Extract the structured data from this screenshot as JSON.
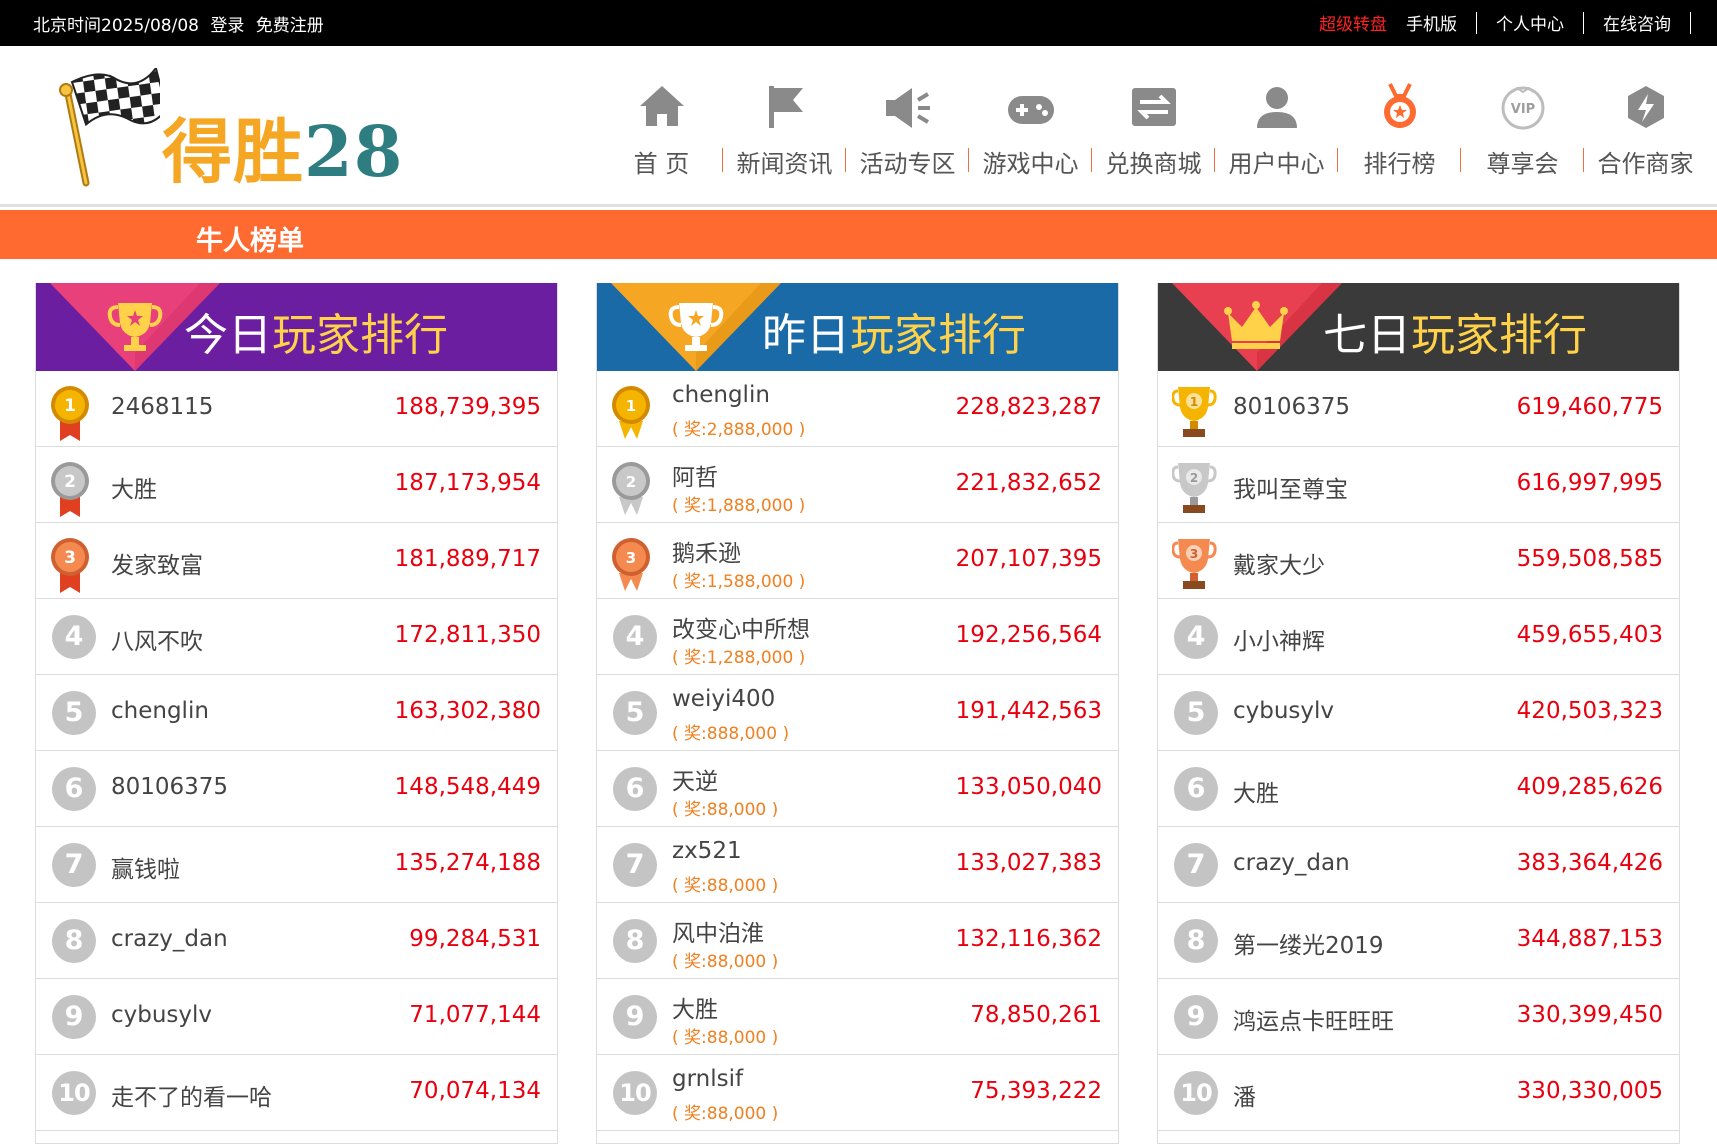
{
  "topbar": {
    "date_text": "北京时间2025/08/08",
    "login": "登录",
    "register": "免费注册",
    "links": [
      "超级转盘",
      "手机版",
      "个人中心",
      "在线咨询"
    ]
  },
  "logo": {
    "text_cn": "得胜",
    "text_num": "28"
  },
  "nav": [
    {
      "label": "首 页",
      "icon": "home-icon"
    },
    {
      "label": "新闻资讯",
      "icon": "flag-icon"
    },
    {
      "label": "活动专区",
      "icon": "megaphone-icon"
    },
    {
      "label": "游戏中心",
      "icon": "gamepad-icon"
    },
    {
      "label": "兑换商城",
      "icon": "exchange-icon"
    },
    {
      "label": "用户中心",
      "icon": "user-icon"
    },
    {
      "label": "排行榜",
      "icon": "medal-icon"
    },
    {
      "label": "尊享会",
      "icon": "vip-icon"
    },
    {
      "label": "合作商家",
      "icon": "partner-icon"
    }
  ],
  "band_title": "牛人榜单",
  "colors": {
    "topbar": "#000000",
    "band": "#ff6a30",
    "score": "#e8000f",
    "prize": "#f08020",
    "panel1": "#6b1fa0",
    "panel2": "#1a6aa8",
    "panel3": "#3a3a3a"
  },
  "panels": [
    {
      "title_white": "今日",
      "title_yellow": "玩家排行",
      "rows": [
        {
          "rank": "1",
          "name": "2468115",
          "score": "188,739,395"
        },
        {
          "rank": "2",
          "name": "大胜",
          "score": "187,173,954"
        },
        {
          "rank": "3",
          "name": "发家致富",
          "score": "181,889,717"
        },
        {
          "rank": "4",
          "name": "八风不吹",
          "score": "172,811,350"
        },
        {
          "rank": "5",
          "name": "chenglin",
          "score": "163,302,380"
        },
        {
          "rank": "6",
          "name": "80106375",
          "score": "148,548,449"
        },
        {
          "rank": "7",
          "name": "赢钱啦",
          "score": "135,274,188"
        },
        {
          "rank": "8",
          "name": "crazy_dan",
          "score": "99,284,531"
        },
        {
          "rank": "9",
          "name": "cybusylv",
          "score": "71,077,144"
        },
        {
          "rank": "10",
          "name": "走不了的看一哈",
          "score": "70,074,134"
        }
      ]
    },
    {
      "title_white": "昨日",
      "title_yellow": "玩家排行",
      "rows": [
        {
          "rank": "1",
          "name": "chenglin",
          "prize": "( 奖:2,888,000 )",
          "score": "228,823,287"
        },
        {
          "rank": "2",
          "name": "阿哲",
          "prize": "( 奖:1,888,000 )",
          "score": "221,832,652"
        },
        {
          "rank": "3",
          "name": "鹅禾逊",
          "prize": "( 奖:1,588,000 )",
          "score": "207,107,395"
        },
        {
          "rank": "4",
          "name": "改变心中所想",
          "prize": "( 奖:1,288,000 )",
          "score": "192,256,564"
        },
        {
          "rank": "5",
          "name": "weiyi400",
          "prize": "( 奖:888,000 )",
          "score": "191,442,563"
        },
        {
          "rank": "6",
          "name": "天逆",
          "prize": "( 奖:88,000 )",
          "score": "133,050,040"
        },
        {
          "rank": "7",
          "name": "zx521",
          "prize": "( 奖:88,000 )",
          "score": "133,027,383"
        },
        {
          "rank": "8",
          "name": "风中泊淮",
          "prize": "( 奖:88,000 )",
          "score": "132,116,362"
        },
        {
          "rank": "9",
          "name": "大胜",
          "prize": "( 奖:88,000 )",
          "score": "78,850,261"
        },
        {
          "rank": "10",
          "name": "grnlsif",
          "prize": "( 奖:88,000 )",
          "score": "75,393,222"
        }
      ]
    },
    {
      "title_white": "七日",
      "title_yellow": "玩家排行",
      "rows": [
        {
          "rank": "1",
          "name": "80106375",
          "score": "619,460,775"
        },
        {
          "rank": "2",
          "name": "我叫至尊宝",
          "score": "616,997,995"
        },
        {
          "rank": "3",
          "name": "戴家大少",
          "score": "559,508,585"
        },
        {
          "rank": "4",
          "name": "小小神辉",
          "score": "459,655,403"
        },
        {
          "rank": "5",
          "name": "cybusylv",
          "score": "420,503,323"
        },
        {
          "rank": "6",
          "name": "大胜",
          "score": "409,285,626"
        },
        {
          "rank": "7",
          "name": "crazy_dan",
          "score": "383,364,426"
        },
        {
          "rank": "8",
          "name": "第一缕光2019",
          "score": "344,887,153"
        },
        {
          "rank": "9",
          "name": "鸿运点卡旺旺旺",
          "score": "330,399,450"
        },
        {
          "rank": "10",
          "name": "潘",
          "score": "330,330,005"
        }
      ]
    }
  ]
}
